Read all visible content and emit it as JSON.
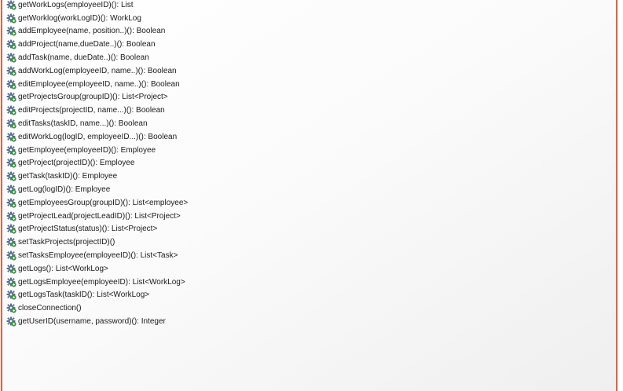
{
  "operations": [
    {
      "signature": "getWorkLogs(employeeID)(): List",
      "icon": "public-operation-icon"
    },
    {
      "signature": "getWorklog(workLogID)(): WorkLog",
      "icon": "public-operation-icon"
    },
    {
      "signature": "addEmployee(name, position..)(): Boolean",
      "icon": "public-operation-icon"
    },
    {
      "signature": "addProject(name,dueDate..)(): Boolean",
      "icon": "public-operation-icon"
    },
    {
      "signature": "addTask(name, dueDate..)(): Boolean",
      "icon": "public-operation-icon"
    },
    {
      "signature": "addWorkLog(employeeID, name..)(): Boolean",
      "icon": "public-operation-icon"
    },
    {
      "signature": "editEmployee(employeeID, name..)(): Boolean",
      "icon": "public-operation-icon"
    },
    {
      "signature": "getProjectsGroup(groupID)(): List<Project>",
      "icon": "public-operation-icon"
    },
    {
      "signature": "editProjects(projectID, name...)(): Boolean",
      "icon": "public-operation-icon"
    },
    {
      "signature": "editTasks(taskID, name...)(): Boolean",
      "icon": "public-operation-icon"
    },
    {
      "signature": "editWorkLog(logID, employeeID...)(): Boolean",
      "icon": "public-operation-icon"
    },
    {
      "signature": "getEmployee(employeeID)(): Employee",
      "icon": "public-operation-icon"
    },
    {
      "signature": "getProject(projectID)(): Employee",
      "icon": "public-operation-icon"
    },
    {
      "signature": "getTask(taskID)(): Employee",
      "icon": "public-operation-icon"
    },
    {
      "signature": "getLog(logID)(): Employee",
      "icon": "public-operation-icon"
    },
    {
      "signature": "getEmployeesGroup(groupID)(): List<employee>",
      "icon": "public-operation-icon"
    },
    {
      "signature": "getProjectLead(projectLeadID)(): List<Project>",
      "icon": "public-operation-icon"
    },
    {
      "signature": "getProjectStatus(status)(): List<Project>",
      "icon": "public-operation-icon"
    },
    {
      "signature": "setTaskProjects(projectID)()",
      "icon": "public-operation-icon"
    },
    {
      "signature": "setTasksEmployee(employeeID)(): List<Task>",
      "icon": "public-operation-icon"
    },
    {
      "signature": "getLogs(): List<WorkLog>",
      "icon": "public-operation-icon"
    },
    {
      "signature": "getLogsEmployee(employeeID): List<WorkLog>",
      "icon": "public-operation-icon"
    },
    {
      "signature": "getLogsTask(taskID(): List<WorkLog>",
      "icon": "public-operation-icon"
    },
    {
      "signature": "closeConnection()",
      "icon": "public-operation-icon"
    },
    {
      "signature": "getUserID(username, password)(): Integer",
      "icon": "public-operation-icon"
    }
  ],
  "colors": {
    "border": "#e8603c",
    "icon_gear": "#5a6e8c",
    "icon_badge": "#2e9e3e"
  }
}
